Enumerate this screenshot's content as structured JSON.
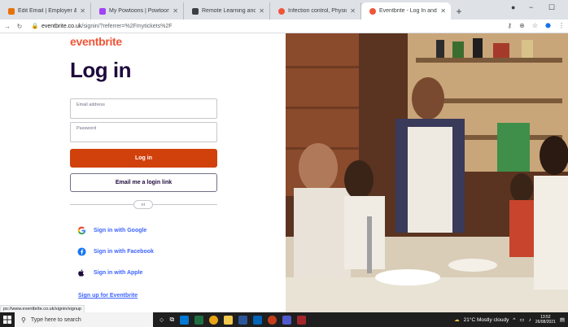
{
  "browser": {
    "tabs": [
      {
        "title": "Edit Email | Employer & Learner",
        "color": "#e8710a",
        "active": false,
        "width": 112
      },
      {
        "title": "My Powtoons | Powtoon",
        "color": "#a142f4",
        "active": false,
        "width": 114
      },
      {
        "title": "Remote Learning and Communic",
        "color": "#3c4043",
        "active": false,
        "width": 106
      },
      {
        "title": "Infection control, Physical care",
        "color": "#f05537",
        "active": false,
        "width": 112
      },
      {
        "title": "Eventbrite - Log In and Sign In",
        "color": "#f05537",
        "active": true,
        "width": 110
      }
    ],
    "new_tab_glyph": "+",
    "window_controls": {
      "minimize": "−",
      "maximize": "☐"
    },
    "address": {
      "host": "eventbrite.co.uk",
      "path": "/signin/?referrer=%2Fmytickets%2F"
    }
  },
  "page": {
    "logo": "eventbrite",
    "title": "Log in",
    "email_label": "Email address",
    "password_label": "Password",
    "login_button": "Log in",
    "email_link_button": "Email me a login link",
    "or_label": "or",
    "social": [
      {
        "label": "Sign in with Google",
        "icon": "google-icon"
      },
      {
        "label": "Sign in with Facebook",
        "icon": "facebook-icon"
      },
      {
        "label": "Sign in with Apple",
        "icon": "apple-icon"
      }
    ],
    "signup_link": "Sign up for Eventbrite",
    "status_url": "ps://www.eventbrite.co.uk/signin/signup",
    "photo": "cooking-class-photo"
  },
  "taskbar": {
    "search_placeholder": "Type here to search",
    "weather": "21°C  Mostly cloudy",
    "time": "13:52",
    "date": "26/08/2021"
  },
  "colors": {
    "brand_orange": "#f05537",
    "login_button": "#d1410c",
    "link_blue": "#3d64ff",
    "title_navy": "#1e0a3c"
  }
}
